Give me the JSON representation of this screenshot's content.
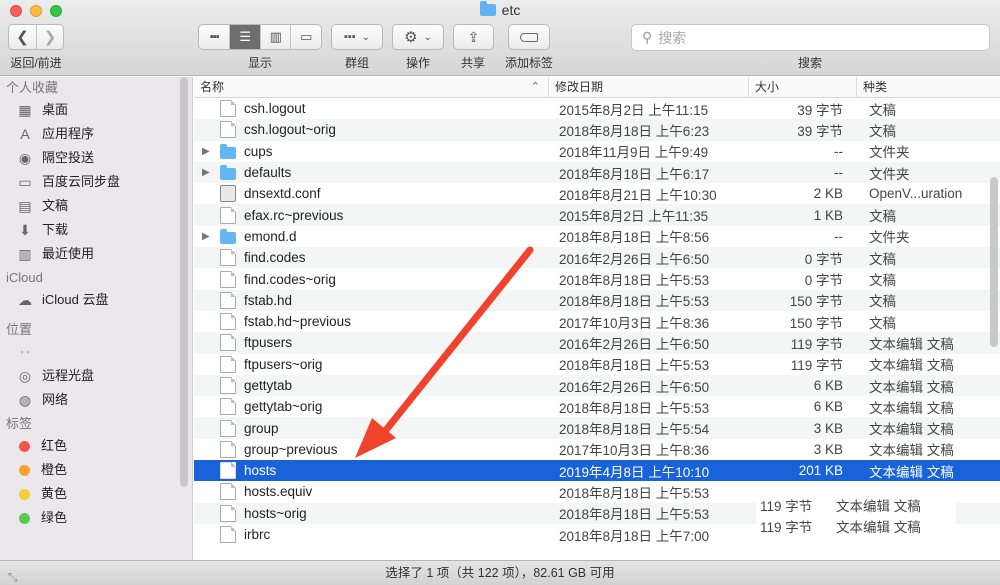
{
  "window": {
    "title": "etc",
    "toolbar_labels": {
      "nav": "返回/前进",
      "view": "显示",
      "group": "群组",
      "action": "操作",
      "share": "共享",
      "tag": "添加标签",
      "search": "搜索"
    },
    "search_placeholder": "搜索"
  },
  "sidebar": {
    "favorites_title": "个人收藏",
    "favorites": [
      {
        "label": "桌面",
        "icon": "desktop-icon",
        "glyph": "▦"
      },
      {
        "label": "应用程序",
        "icon": "applications-icon",
        "glyph": "A"
      },
      {
        "label": "隔空投送",
        "icon": "airdrop-icon",
        "glyph": "◉"
      },
      {
        "label": "百度云同步盘",
        "icon": "folder-icon",
        "glyph": "▭"
      },
      {
        "label": "文稿",
        "icon": "documents-icon",
        "glyph": "▤"
      },
      {
        "label": "下载",
        "icon": "download-icon",
        "glyph": "⬇"
      },
      {
        "label": "最近使用",
        "icon": "recents-icon",
        "glyph": "▥"
      }
    ],
    "icloud_title": "iCloud",
    "icloud": [
      {
        "label": "iCloud 云盘",
        "icon": "cloud-icon",
        "glyph": "☁"
      }
    ],
    "locations_title": "位置",
    "locations": [
      {
        "label": "远程光盘",
        "icon": "disc-icon",
        "glyph": "◎"
      },
      {
        "label": "网络",
        "icon": "network-icon",
        "glyph": "◍"
      }
    ],
    "tags_title": "标签",
    "tags": [
      {
        "label": "红色",
        "color": "#f4564f"
      },
      {
        "label": "橙色",
        "color": "#f7a133"
      },
      {
        "label": "黄色",
        "color": "#f5cd38"
      },
      {
        "label": "绿色",
        "color": "#5cc854"
      }
    ]
  },
  "columns": {
    "name": "名称",
    "date": "修改日期",
    "size": "大小",
    "kind": "种类"
  },
  "files": [
    {
      "name": "csh.logout",
      "date": "2015年8月2日 上午11:15",
      "size": "39 字节",
      "kind": "文稿",
      "icon": "doc"
    },
    {
      "name": "csh.logout~orig",
      "date": "2018年8月18日 上午6:23",
      "size": "39 字节",
      "kind": "文稿",
      "icon": "doc"
    },
    {
      "name": "cups",
      "date": "2018年11月9日 上午9:49",
      "size": "--",
      "kind": "文件夹",
      "icon": "folder"
    },
    {
      "name": "defaults",
      "date": "2018年8月18日 上午6:17",
      "size": "--",
      "kind": "文件夹",
      "icon": "folder"
    },
    {
      "name": "dnsextd.conf",
      "date": "2018年8月21日 上午10:30",
      "size": "2 KB",
      "kind": "OpenV...uration",
      "icon": "exec"
    },
    {
      "name": "efax.rc~previous",
      "date": "2015年8月2日 上午11:35",
      "size": "1 KB",
      "kind": "文稿",
      "icon": "doc"
    },
    {
      "name": "emond.d",
      "date": "2018年8月18日 上午8:56",
      "size": "--",
      "kind": "文件夹",
      "icon": "folder"
    },
    {
      "name": "find.codes",
      "date": "2016年2月26日 上午6:50",
      "size": "0 字节",
      "kind": "文稿",
      "icon": "doc"
    },
    {
      "name": "find.codes~orig",
      "date": "2018年8月18日 上午5:53",
      "size": "0 字节",
      "kind": "文稿",
      "icon": "doc"
    },
    {
      "name": "fstab.hd",
      "date": "2018年8月18日 上午5:53",
      "size": "150 字节",
      "kind": "文稿",
      "icon": "doc"
    },
    {
      "name": "fstab.hd~previous",
      "date": "2017年10月3日 上午8:36",
      "size": "150 字节",
      "kind": "文稿",
      "icon": "doc"
    },
    {
      "name": "ftpusers",
      "date": "2016年2月26日 上午6:50",
      "size": "119 字节",
      "kind": "文本编辑 文稿",
      "icon": "doc"
    },
    {
      "name": "ftpusers~orig",
      "date": "2018年8月18日 上午5:53",
      "size": "119 字节",
      "kind": "文本编辑 文稿",
      "icon": "doc"
    },
    {
      "name": "gettytab",
      "date": "2016年2月26日 上午6:50",
      "size": "6 KB",
      "kind": "文本编辑 文稿",
      "icon": "doc"
    },
    {
      "name": "gettytab~orig",
      "date": "2018年8月18日 上午5:53",
      "size": "6 KB",
      "kind": "文本编辑 文稿",
      "icon": "doc"
    },
    {
      "name": "group",
      "date": "2018年8月18日 上午5:54",
      "size": "3 KB",
      "kind": "文本编辑 文稿",
      "icon": "doc"
    },
    {
      "name": "group~previous",
      "date": "2017年10月3日 上午8:36",
      "size": "3 KB",
      "kind": "文本编辑 文稿",
      "icon": "doc"
    },
    {
      "name": "hosts",
      "date": "2019年4月8日 上午10:10",
      "size": "201 KB",
      "kind": "文本编辑 文稿",
      "icon": "doc",
      "selected": true
    },
    {
      "name": "hosts.equiv",
      "date": "2018年8月18日 上午5:53",
      "size": "",
      "kind": "",
      "icon": "doc"
    },
    {
      "name": "hosts~orig",
      "date": "2018年8月18日 上午5:53",
      "size": "",
      "kind": "",
      "icon": "doc"
    },
    {
      "name": "irbrc",
      "date": "2018年8月18日 上午7:00",
      "size": "",
      "kind": "",
      "icon": "doc"
    }
  ],
  "ghost_rows": [
    {
      "size": "119 字节",
      "kind": "文本编辑 文稿"
    },
    {
      "size": "119 字节",
      "kind": "文本编辑 文稿"
    }
  ],
  "status": "选择了 1 项（共 122 项），82.61 GB 可用",
  "accent": "#1a62d9",
  "arrow_color": "#f0432d"
}
